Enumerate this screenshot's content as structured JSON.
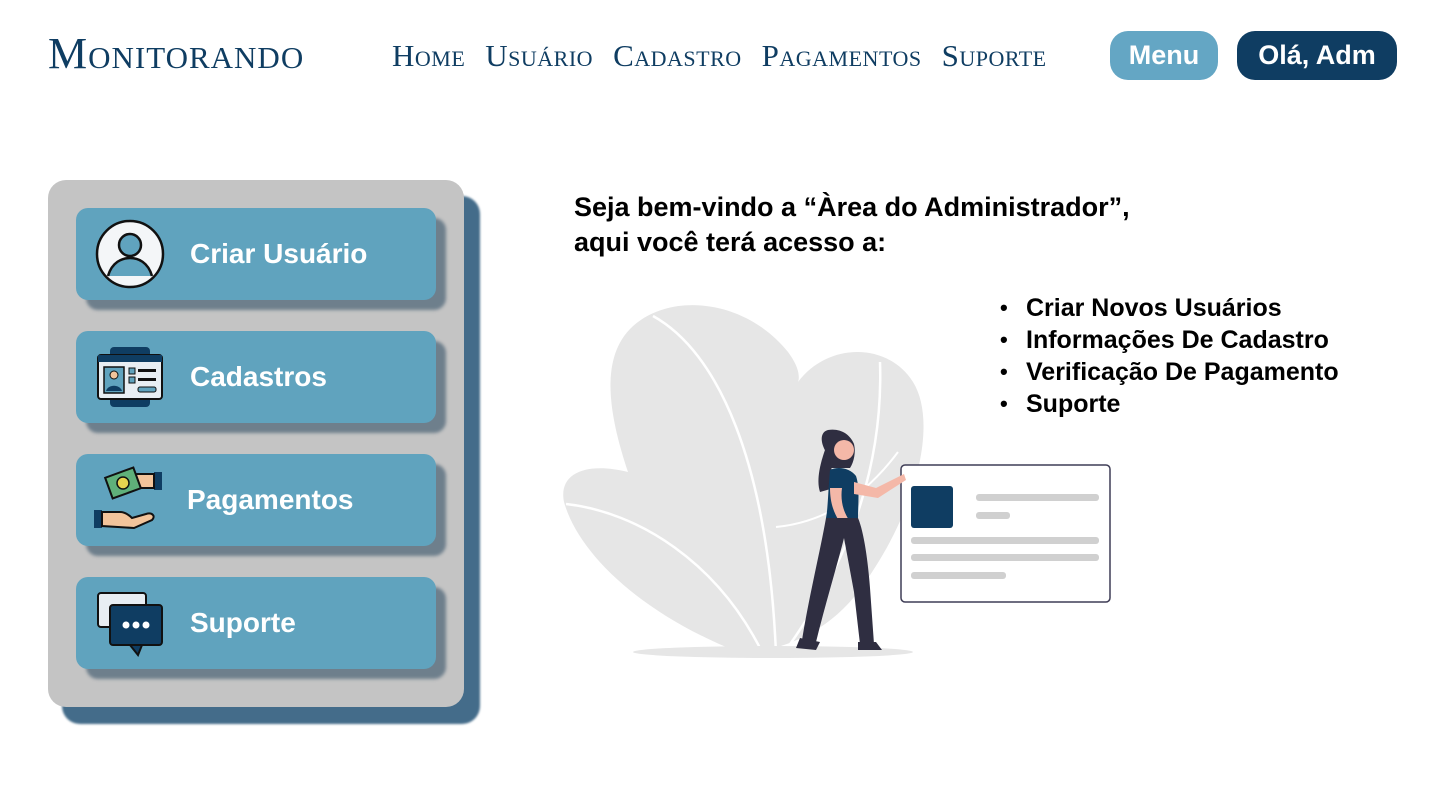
{
  "header": {
    "brand": "Monitorando",
    "nav": [
      "Home",
      "Usuário",
      "Cadastro",
      "Pagamentos",
      "Suporte"
    ],
    "menu_button": "Menu",
    "user_button": "Olá, Adm"
  },
  "sidebar": {
    "cards": [
      {
        "label": "Criar Usuário",
        "icon": "user-avatar-icon"
      },
      {
        "label": "Cadastros",
        "icon": "id-card-icon"
      },
      {
        "label": "Pagamentos",
        "icon": "payment-hands-icon"
      },
      {
        "label": "Suporte",
        "icon": "chat-bubbles-icon"
      }
    ]
  },
  "main": {
    "welcome_line1": "Seja bem-vindo a “Àrea do Administrador”,",
    "welcome_line2": "aqui você terá acesso a:",
    "features": [
      "Criar Novos Usuários",
      "Informações De Cadastro",
      "Verificação De Pagamento",
      "Suporte"
    ],
    "illustration_icon": "woman-with-card-illustration"
  },
  "colors": {
    "navy": "#0f3d62",
    "accent_blue": "#60a3be",
    "panel_gray": "#c4c4c4",
    "panel_shadow": "#446c8a"
  }
}
